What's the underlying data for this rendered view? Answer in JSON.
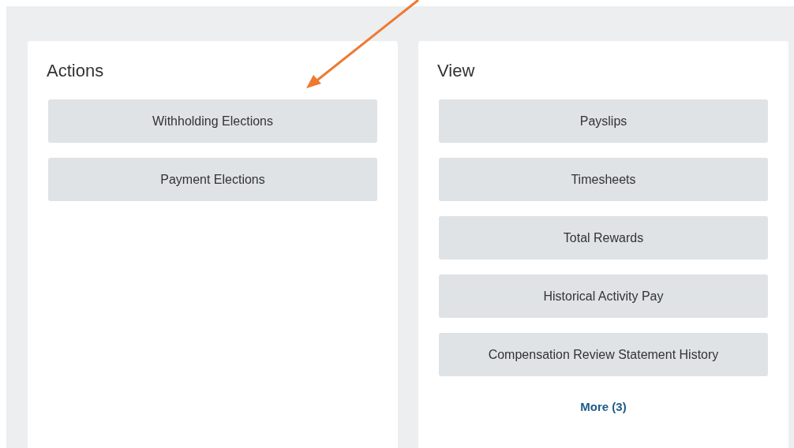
{
  "panels": [
    {
      "title": "Actions",
      "buttons": [
        "Withholding Elections",
        "Payment Elections"
      ]
    },
    {
      "title": "View",
      "buttons": [
        "Payslips",
        "Timesheets",
        "Total Rewards",
        "Historical Activity Pay",
        "Compensation Review Statement History"
      ],
      "more_link": "More (3)"
    }
  ]
}
